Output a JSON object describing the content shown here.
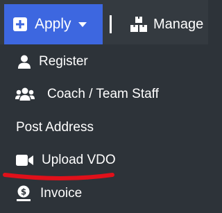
{
  "navbar": {
    "apply_label": "Apply",
    "manage_label": "Manage"
  },
  "dropdown": {
    "items": [
      {
        "label": "Register",
        "icon": "user-icon"
      },
      {
        "label": "Coach / Team Staff",
        "icon": "users-icon"
      },
      {
        "label": "Post Address",
        "icon": ""
      },
      {
        "label": "Upload VDO",
        "icon": "video-icon"
      },
      {
        "label": "Invoice",
        "icon": "receipt-icon"
      }
    ]
  },
  "annotation": {
    "underline_color": "#e0101a"
  },
  "colors": {
    "apply_button": "#3d67e0",
    "navbar": "#343a40",
    "menu_background": "#2d3339",
    "text": "#ffffff"
  }
}
